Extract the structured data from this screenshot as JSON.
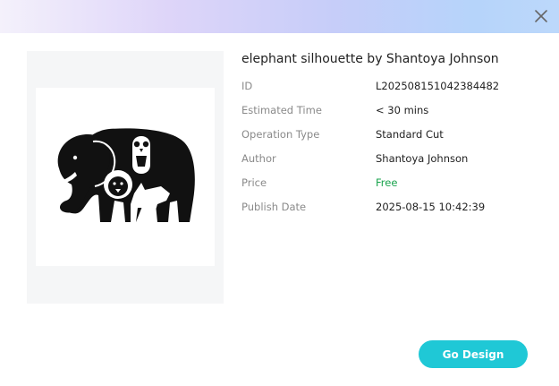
{
  "header": {
    "close_icon": "close-icon"
  },
  "design": {
    "title": "elephant silhouette by Shantoya Johnson",
    "image_icon": "elephant-silhouette-image"
  },
  "details": [
    {
      "label": "ID",
      "value": "L202508151042384482"
    },
    {
      "label": "Estimated Time",
      "value": "< 30 mins"
    },
    {
      "label": "Operation Type",
      "value": "Standard Cut"
    },
    {
      "label": "Author",
      "value": "Shantoya Johnson"
    },
    {
      "label": "Price",
      "value": "Free"
    },
    {
      "label": "Publish Date",
      "value": "2025-08-15 10:42:39"
    }
  ],
  "actions": {
    "go_design_label": "Go Design"
  },
  "colors": {
    "accent": "#1fc8d6",
    "free_text": "#19a34d",
    "label_text": "#8a8a8a"
  }
}
